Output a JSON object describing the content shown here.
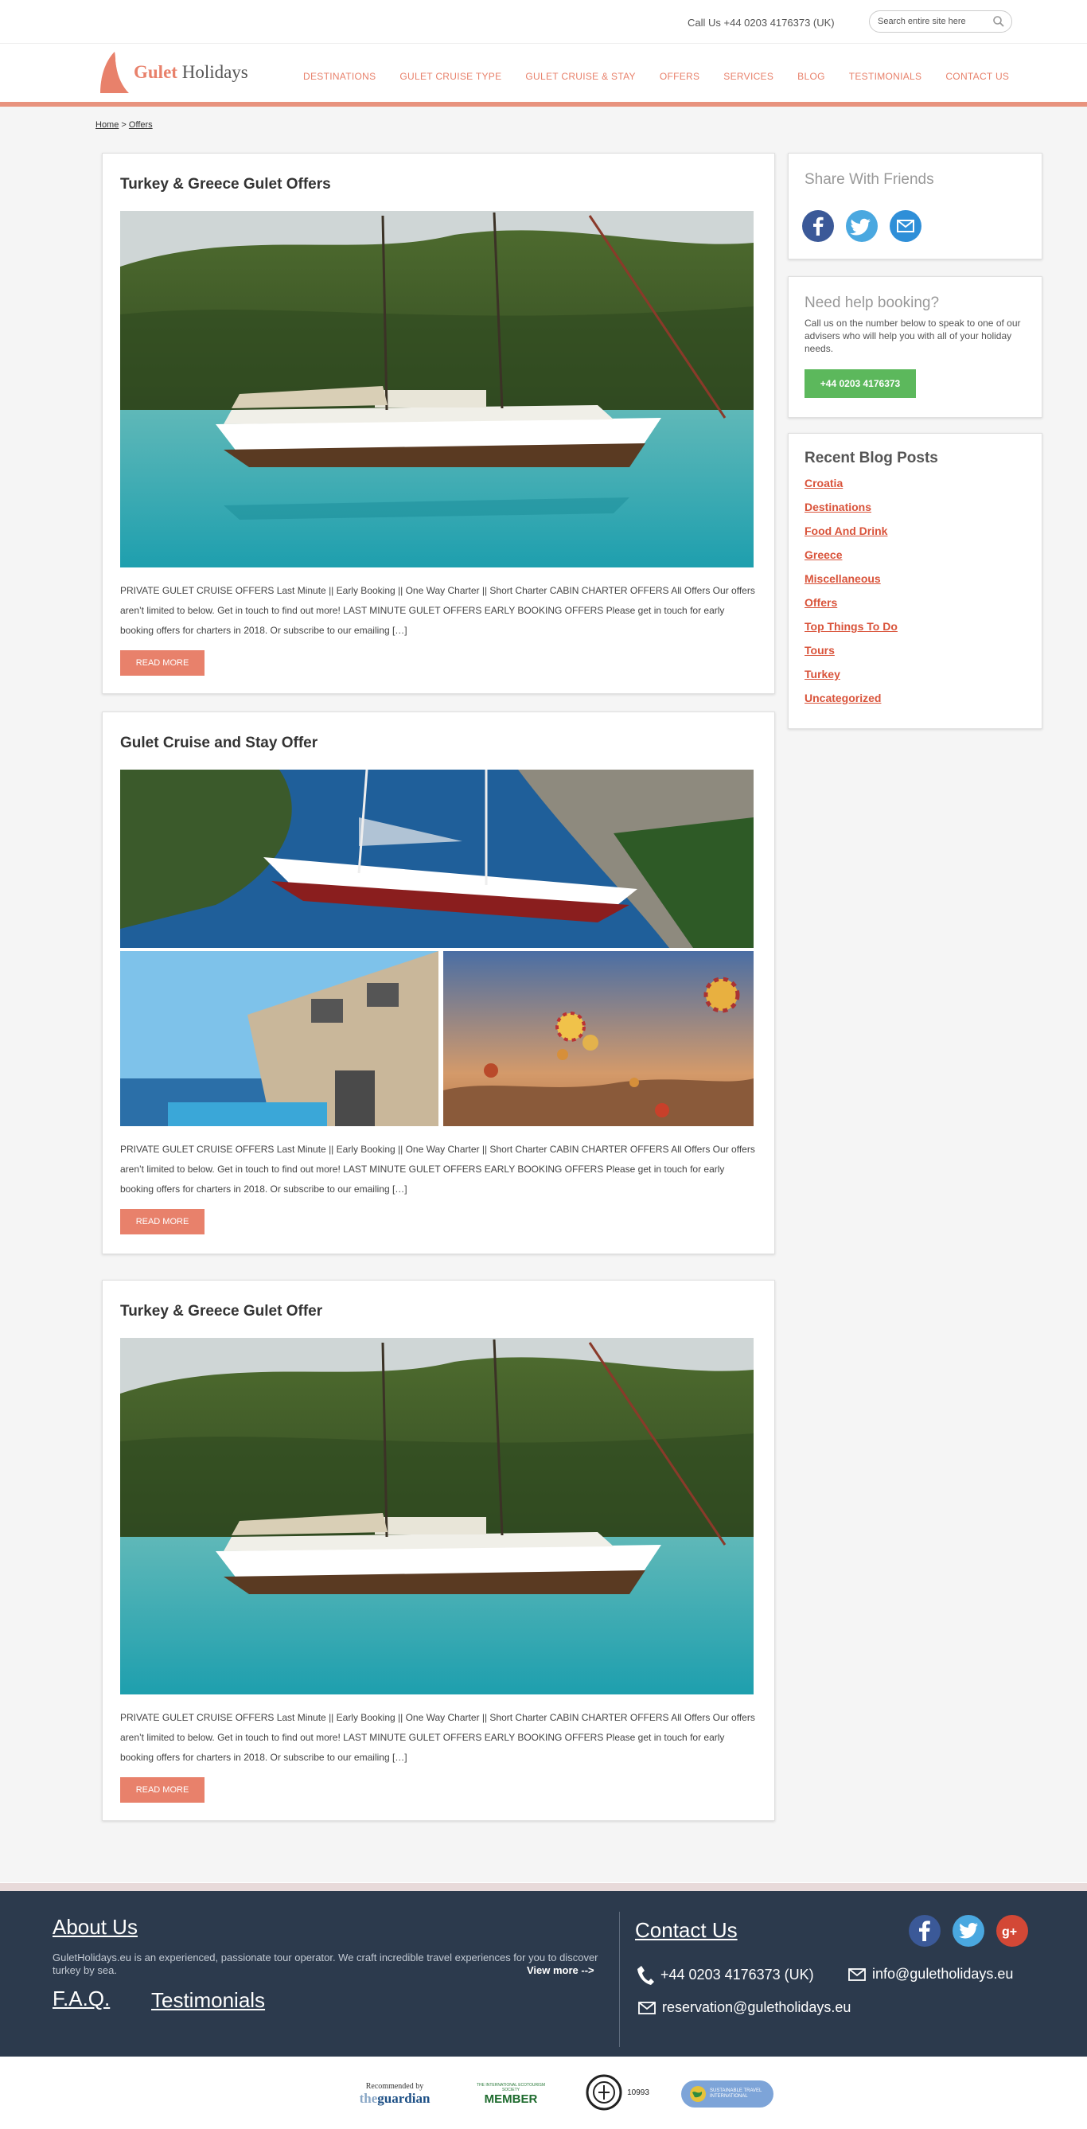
{
  "header": {
    "call_text": "Call Us +44 0203 4176373 (UK)",
    "search_placeholder": "Search entire site here",
    "logo_primary": "Gulet",
    "logo_secondary": "Holidays",
    "nav": [
      "DESTINATIONS",
      "GULET CRUISE TYPE",
      "GULET CRUISE & STAY",
      "OFFERS",
      "SERVICES",
      "BLOG",
      "TESTIMONIALS",
      "CONTACT US"
    ]
  },
  "breadcrumb": {
    "home": "Home",
    "separator": ">",
    "current": "Offers"
  },
  "posts": [
    {
      "title": "Turkey & Greece Gulet Offers",
      "excerpt": "PRIVATE GULET CRUISE OFFERS  Last Minute  ||  Early Booking || One Way Charter  ||  Short Charter CABIN CHARTER OFFERS  All Offers Our offers aren’t limited to below. Get in touch to find out more! LAST MINUTE GULET OFFERS   EARLY BOOKING OFFERS Please get in touch for early booking offers for charters in 2018. Or subscribe to our emailing […]",
      "button": "READ MORE"
    },
    {
      "title": "Gulet Cruise and Stay Offer",
      "excerpt": "PRIVATE GULET CRUISE OFFERS  Last Minute  ||  Early Booking || One Way Charter  ||  Short Charter CABIN CHARTER OFFERS  All Offers Our offers aren’t limited to below. Get in touch to find out more! LAST MINUTE GULET OFFERS   EARLY BOOKING OFFERS Please get in touch for early booking offers for charters in 2018. Or subscribe to our emailing […]",
      "button": "READ MORE"
    },
    {
      "title": "Turkey & Greece Gulet Offer",
      "excerpt": "PRIVATE GULET CRUISE OFFERS  Last Minute  ||  Early Booking || One Way Charter  ||  Short Charter CABIN CHARTER OFFERS  All Offers Our offers aren’t limited to below. Get in touch to find out more! LAST MINUTE GULET OFFERS   EARLY BOOKING OFFERS Please get in touch for early booking offers for charters in 2018. Or subscribe to our emailing […]",
      "button": "READ MORE"
    }
  ],
  "sidebar": {
    "share_title": "Share With Friends",
    "share_icons": [
      "facebook-icon",
      "twitter-icon",
      "email-icon"
    ],
    "help_title": "Need help booking?",
    "help_text": "Call us on the number below to speak to one of our advisers who will help you with all of your holiday needs.",
    "help_phone": "+44 0203 4176373",
    "blog_title": "Recent Blog Posts",
    "blog_items": [
      "Croatia",
      "Destinations",
      "Food And Drink",
      "Greece",
      "Miscellaneous",
      "Offers",
      "Top Things To Do",
      "Tours",
      "Turkey",
      "Uncategorized"
    ]
  },
  "footer": {
    "about_title": "About Us",
    "about_text": "GuletHolidays.eu is an experienced, passionate tour operator. We craft incredible travel experiences for you to discover turkey by sea.",
    "view_more": "View more -->",
    "faq": "F.A.Q.",
    "testimonials": "Testimonials",
    "contact_title": "Contact Us",
    "phone": "+44 0203 4176373 (UK)",
    "email1": "info@guletholidays.eu",
    "email2": "reservation@guletholidays.eu"
  },
  "badges": {
    "guardian_top": "Recommended by",
    "guardian_the": "the",
    "guardian_name": "guardian",
    "ecotourism_small": "THE INTERNATIONAL ECOTOURISM SOCIETY",
    "ecotourism_member": "MEMBER",
    "tursab_number": "10993",
    "sustainable_text": "SUSTAINABLE TRAVEL INTERNATIONAL"
  },
  "colors": {
    "accent": "#e8816b",
    "green": "#5cb85c",
    "footer_bg": "#2c3a4d",
    "link_red": "#d9533a"
  }
}
